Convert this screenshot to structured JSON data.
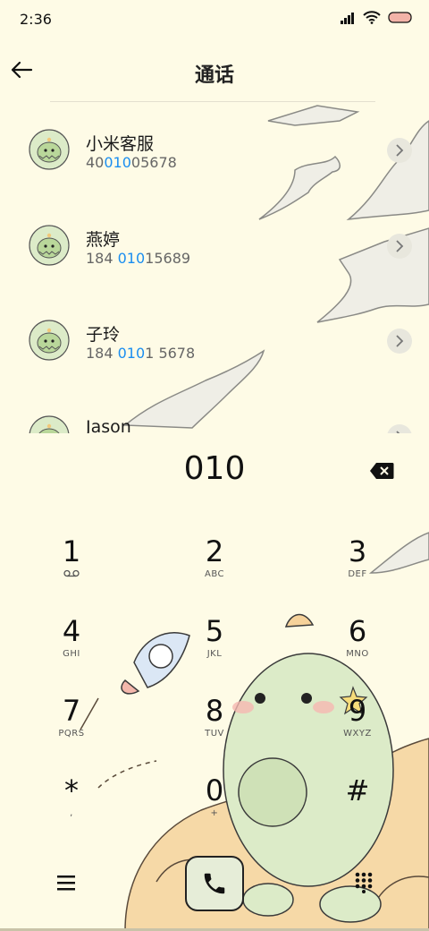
{
  "status_bar": {
    "time": "2:36"
  },
  "header": {
    "title": "通话"
  },
  "contacts": [
    {
      "name": "小米客服",
      "number_pre": "40",
      "number_match": "010",
      "number_post": "05678"
    },
    {
      "name": "燕婷",
      "number_pre": "184 ",
      "number_match": "010",
      "number_post": "15689"
    },
    {
      "name": "子玲",
      "number_pre": "184 ",
      "number_match": "010",
      "number_post": "1 5678"
    },
    {
      "name": "Jason",
      "number_pre": "",
      "number_match": "",
      "number_post": ""
    }
  ],
  "dialer": {
    "input": "010",
    "keys": [
      {
        "digit": "1",
        "sub": ""
      },
      {
        "digit": "2",
        "sub": "ABC"
      },
      {
        "digit": "3",
        "sub": "DEF"
      },
      {
        "digit": "4",
        "sub": "GHI"
      },
      {
        "digit": "5",
        "sub": "JKL"
      },
      {
        "digit": "6",
        "sub": "MNO"
      },
      {
        "digit": "7",
        "sub": "PQRS"
      },
      {
        "digit": "8",
        "sub": "TUV"
      },
      {
        "digit": "9",
        "sub": "WXYZ"
      },
      {
        "digit": "*",
        "sub": ","
      },
      {
        "digit": "0",
        "sub": "+"
      },
      {
        "digit": "#",
        "sub": ""
      }
    ]
  },
  "icons": {
    "back": "arrow-left-icon",
    "backspace": "backspace-icon",
    "menu": "menu-icon",
    "call": "phone-icon",
    "keypad": "keypad-icon",
    "voicemail": "voicemail-icon"
  },
  "colors": {
    "background": "#fefbe6",
    "highlight": "#1a8ef0",
    "call_button": "#e6edd8"
  }
}
